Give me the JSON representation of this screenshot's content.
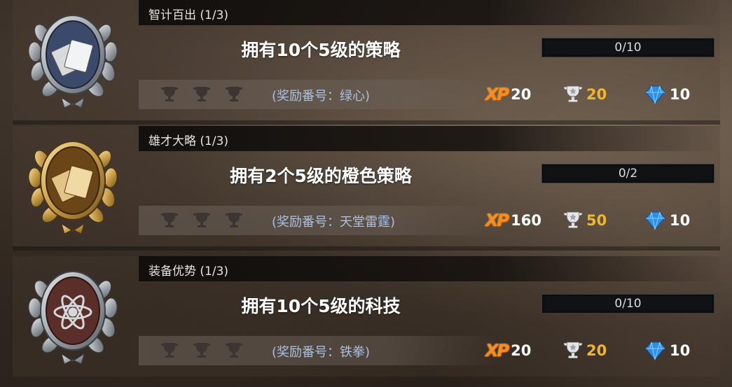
{
  "achievements": [
    {
      "header": "智计百出 (1/3)",
      "title": "拥有10个5级的策略",
      "progress_text": "0/10",
      "progress": 0,
      "reward_code": "(奖励番号：绿心)",
      "xp_label": "XP",
      "xp": "20",
      "trophies": "20",
      "gems": "10",
      "medal_icon": "cards-icon",
      "medal_color": "#3b4a6b"
    },
    {
      "header": "雄才大略 (1/3)",
      "title": "拥有2个5级的橙色策略",
      "progress_text": "0/2",
      "progress": 0,
      "reward_code": "(奖励番号：天堂雷霆)",
      "xp_label": "XP",
      "xp": "160",
      "trophies": "50",
      "gems": "10",
      "medal_icon": "cards-icon",
      "medal_color": "#6a4518"
    },
    {
      "header": "装备优势 (1/3)",
      "title": "拥有10个5级的科技",
      "progress_text": "0/10",
      "progress": 0,
      "reward_code": "(奖励番号：铁拳)",
      "xp_label": "XP",
      "xp": "20",
      "trophies": "20",
      "gems": "10",
      "medal_icon": "atom-icon",
      "medal_color": "#5a2f2a"
    }
  ]
}
